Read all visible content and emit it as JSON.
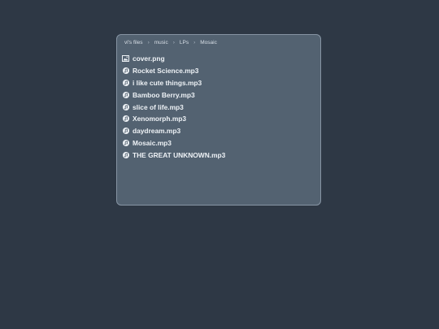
{
  "breadcrumb": [
    {
      "label": "vl's files"
    },
    {
      "label": "music"
    },
    {
      "label": "LPs"
    },
    {
      "label": "Mosaic"
    }
  ],
  "breadcrumb_separator": "›",
  "files": [
    {
      "name": "cover.png",
      "icon": "image-icon"
    },
    {
      "name": "Rocket Science.mp3",
      "icon": "music-icon"
    },
    {
      "name": "i like cute things.mp3",
      "icon": "music-icon"
    },
    {
      "name": "Bamboo Berry.mp3",
      "icon": "music-icon"
    },
    {
      "name": "slice of life.mp3",
      "icon": "music-icon"
    },
    {
      "name": "Xenomorph.mp3",
      "icon": "music-icon"
    },
    {
      "name": "daydream.mp3",
      "icon": "music-icon"
    },
    {
      "name": "Mosaic.mp3",
      "icon": "music-icon"
    },
    {
      "name": "THE GREAT UNKNOWN.mp3",
      "icon": "music-icon"
    }
  ],
  "colors": {
    "background": "#2e3845",
    "panel": "#536271",
    "panel_border": "#8694a3",
    "text": "#eef2f6"
  }
}
